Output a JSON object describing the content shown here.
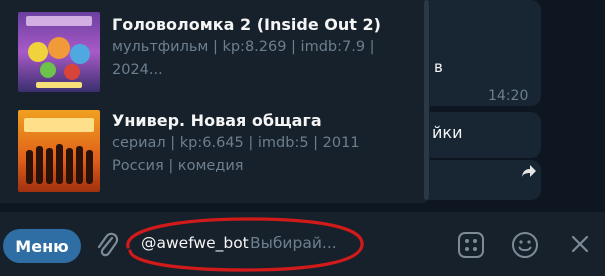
{
  "results": [
    {
      "title": "Головоломка 2 (Inside Out 2)",
      "desc": "мультфильм | kp:8.269 | imdb:7.9 | 2024..."
    },
    {
      "title": "Универ. Новая общага",
      "desc": "сериал | kp:6.645 | imdb:5 | 2011 Россия | комедия"
    }
  ],
  "chat": {
    "letter": "в",
    "time": "14:20",
    "word": "йки"
  },
  "composer": {
    "menu_label": "Меню",
    "bot_username": "@awefwe_bot",
    "placeholder": "Выбирай..."
  },
  "colors": {
    "accent": "#2f6ea5",
    "highlight": "#d11a1a"
  }
}
